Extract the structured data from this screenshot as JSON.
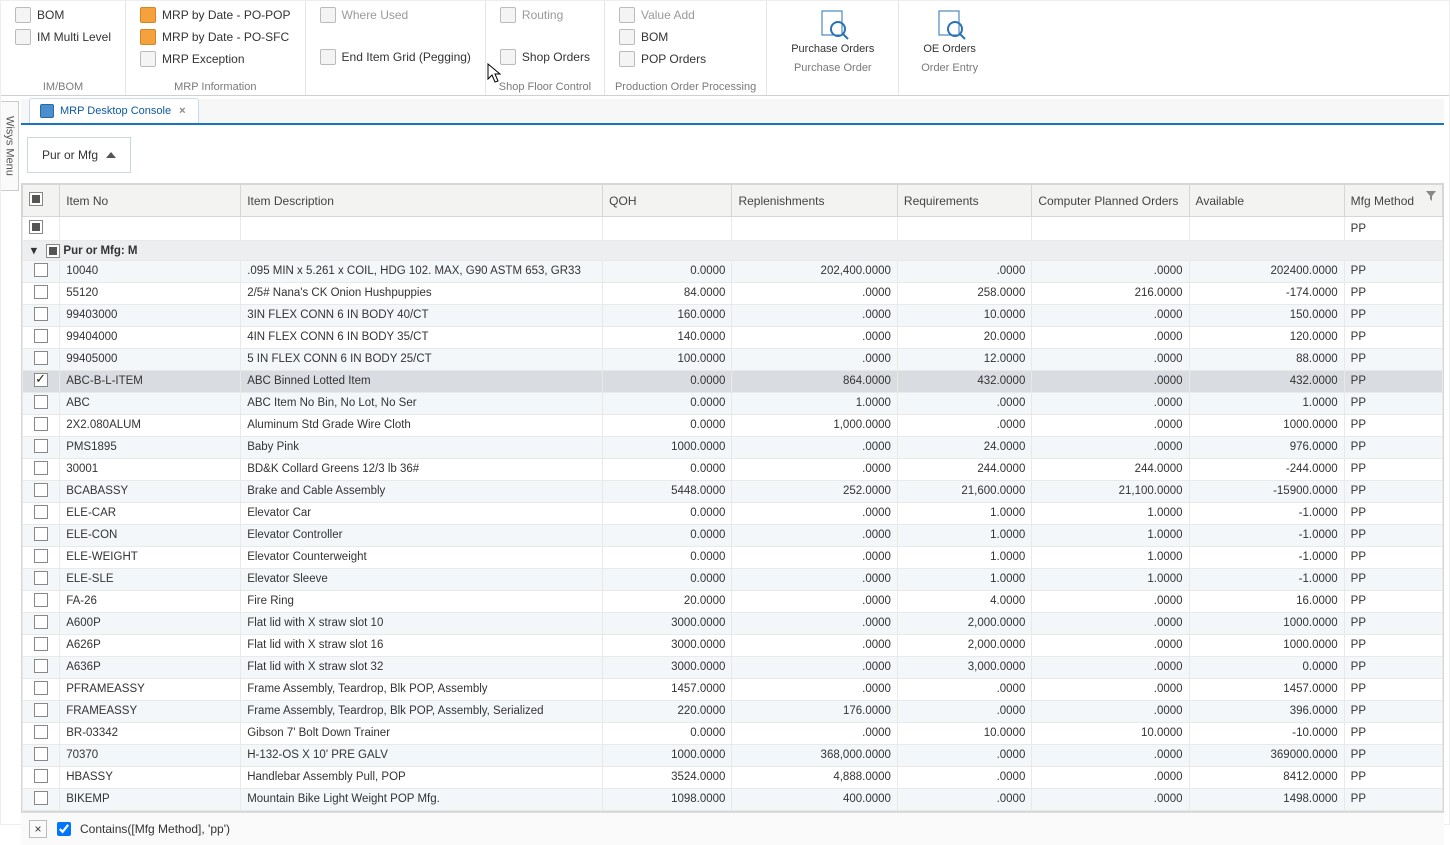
{
  "ribbon": {
    "group1": {
      "bom": "BOM",
      "imMulti": "IM Multi Level",
      "label": "IM/BOM"
    },
    "group2": {
      "byDatePop": "MRP by Date - PO-POP",
      "byDateSfc": "MRP by Date - PO-SFC",
      "exception": "MRP Exception",
      "label": "MRP Information"
    },
    "group3": {
      "whereUsed": "Where Used",
      "endItem": "End Item Grid (Pegging)"
    },
    "group4": {
      "routing": "Routing",
      "shopOrders": "Shop Orders",
      "label": "Shop Floor Control"
    },
    "group5": {
      "valueAdd": "Value Add",
      "bom": "BOM",
      "popOrders": "POP Orders",
      "label": "Production Order Processing"
    },
    "group6": {
      "purchase": "Purchase Orders",
      "label": "Purchase Order"
    },
    "group7": {
      "oe": "OE Orders",
      "label": "Order Entry"
    }
  },
  "sideTab": "Wisys Menu",
  "tab": {
    "title": "MRP Desktop Console"
  },
  "groupChip": {
    "label": "Pur or Mfg"
  },
  "columns": {
    "itemNo": "Item No",
    "desc": "Item Description",
    "qoh": "QOH",
    "repl": "Replenishments",
    "req": "Requirements",
    "cpo": "Computer Planned Orders",
    "avail": "Available",
    "mfg": "Mfg Method"
  },
  "filterRow": {
    "mfg": "PP"
  },
  "groupRow": "Pur or Mfg: M",
  "rows": [
    {
      "chk": false,
      "no": "10040",
      "desc": ".095 MIN x 5.261 x COIL, HDG   102. MAX, G90 ASTM 653, GR33",
      "qoh": "0.0000",
      "repl": "202,400.0000",
      "req": ".0000",
      "cpo": ".0000",
      "avail": "202400.0000",
      "mfg": "PP"
    },
    {
      "chk": false,
      "no": "55120",
      "desc": "2/5# Nana's CK Onion          Hushpuppies",
      "qoh": "84.0000",
      "repl": ".0000",
      "req": "258.0000",
      "cpo": "216.0000",
      "avail": "-174.0000",
      "mfg": "PP"
    },
    {
      "chk": false,
      "no": "99403000",
      "desc": "3IN FLEX CONN 6 IN BODY 40/CT",
      "qoh": "160.0000",
      "repl": ".0000",
      "req": "10.0000",
      "cpo": ".0000",
      "avail": "150.0000",
      "mfg": "PP"
    },
    {
      "chk": false,
      "no": "99404000",
      "desc": "4IN FLEX CONN 6 IN BODY 35/CT",
      "qoh": "140.0000",
      "repl": ".0000",
      "req": "20.0000",
      "cpo": ".0000",
      "avail": "120.0000",
      "mfg": "PP"
    },
    {
      "chk": false,
      "no": "99405000",
      "desc": "5 IN FLEX CONN 6 IN BODY 25/CT",
      "qoh": "100.0000",
      "repl": ".0000",
      "req": "12.0000",
      "cpo": ".0000",
      "avail": "88.0000",
      "mfg": "PP"
    },
    {
      "chk": true,
      "sel": true,
      "no": "ABC-B-L-ITEM",
      "desc": "ABC Binned Lotted Item",
      "qoh": "0.0000",
      "repl": "864.0000",
      "req": "432.0000",
      "cpo": ".0000",
      "avail": "432.0000",
      "mfg": "PP"
    },
    {
      "chk": false,
      "no": "ABC",
      "desc": "ABC Item                     No Bin, No Lot, No Ser",
      "qoh": "0.0000",
      "repl": "1.0000",
      "req": ".0000",
      "cpo": ".0000",
      "avail": "1.0000",
      "mfg": "PP"
    },
    {
      "chk": false,
      "no": "2X2.080ALUM",
      "desc": "Aluminum Std Grade Wire Cloth",
      "qoh": "0.0000",
      "repl": "1,000.0000",
      "req": ".0000",
      "cpo": ".0000",
      "avail": "1000.0000",
      "mfg": "PP"
    },
    {
      "chk": false,
      "no": "PMS1895",
      "desc": "Baby Pink",
      "qoh": "1000.0000",
      "repl": ".0000",
      "req": "24.0000",
      "cpo": ".0000",
      "avail": "976.0000",
      "mfg": "PP"
    },
    {
      "chk": false,
      "no": "30001",
      "desc": "BD&K Collard Greens          12/3 lb 36#",
      "qoh": "0.0000",
      "repl": ".0000",
      "req": "244.0000",
      "cpo": "244.0000",
      "avail": "-244.0000",
      "mfg": "PP"
    },
    {
      "chk": false,
      "no": "BCABASSY",
      "desc": "Brake and Cable Assembly",
      "qoh": "5448.0000",
      "repl": "252.0000",
      "req": "21,600.0000",
      "cpo": "21,100.0000",
      "avail": "-15900.0000",
      "mfg": "PP"
    },
    {
      "chk": false,
      "no": "ELE-CAR",
      "desc": "Elevator Car",
      "qoh": "0.0000",
      "repl": ".0000",
      "req": "1.0000",
      "cpo": "1.0000",
      "avail": "-1.0000",
      "mfg": "PP"
    },
    {
      "chk": false,
      "no": "ELE-CON",
      "desc": "Elevator Controller",
      "qoh": "0.0000",
      "repl": ".0000",
      "req": "1.0000",
      "cpo": "1.0000",
      "avail": "-1.0000",
      "mfg": "PP"
    },
    {
      "chk": false,
      "no": "ELE-WEIGHT",
      "desc": "Elevator Counterweight",
      "qoh": "0.0000",
      "repl": ".0000",
      "req": "1.0000",
      "cpo": "1.0000",
      "avail": "-1.0000",
      "mfg": "PP"
    },
    {
      "chk": false,
      "no": "ELE-SLE",
      "desc": "Elevator Sleeve",
      "qoh": "0.0000",
      "repl": ".0000",
      "req": "1.0000",
      "cpo": "1.0000",
      "avail": "-1.0000",
      "mfg": "PP"
    },
    {
      "chk": false,
      "no": "FA-26",
      "desc": "Fire Ring",
      "qoh": "20.0000",
      "repl": ".0000",
      "req": "4.0000",
      "cpo": ".0000",
      "avail": "16.0000",
      "mfg": "PP"
    },
    {
      "chk": false,
      "no": "A600P",
      "desc": "Flat lid with X straw slot 10",
      "qoh": "3000.0000",
      "repl": ".0000",
      "req": "2,000.0000",
      "cpo": ".0000",
      "avail": "1000.0000",
      "mfg": "PP"
    },
    {
      "chk": false,
      "no": "A626P",
      "desc": "Flat lid with X straw slot 16",
      "qoh": "3000.0000",
      "repl": ".0000",
      "req": "2,000.0000",
      "cpo": ".0000",
      "avail": "1000.0000",
      "mfg": "PP"
    },
    {
      "chk": false,
      "no": "A636P",
      "desc": "Flat lid with X straw slot 32",
      "qoh": "3000.0000",
      "repl": ".0000",
      "req": "3,000.0000",
      "cpo": ".0000",
      "avail": "0.0000",
      "mfg": "PP"
    },
    {
      "chk": false,
      "no": "PFRAMEASSY",
      "desc": "Frame Assembly, Teardrop, Blk POP, Assembly",
      "qoh": "1457.0000",
      "repl": ".0000",
      "req": ".0000",
      "cpo": ".0000",
      "avail": "1457.0000",
      "mfg": "PP"
    },
    {
      "chk": false,
      "no": "FRAMEASSY",
      "desc": "Frame Assembly, Teardrop, Blk POP, Assembly, Serialized",
      "qoh": "220.0000",
      "repl": "176.0000",
      "req": ".0000",
      "cpo": ".0000",
      "avail": "396.0000",
      "mfg": "PP"
    },
    {
      "chk": false,
      "no": "BR-03342",
      "desc": "Gibson 7' Bolt Down Trainer",
      "qoh": "0.0000",
      "repl": ".0000",
      "req": "10.0000",
      "cpo": "10.0000",
      "avail": "-10.0000",
      "mfg": "PP"
    },
    {
      "chk": false,
      "no": "70370",
      "desc": "H-132-OS X 10' PRE GALV",
      "qoh": "1000.0000",
      "repl": "368,000.0000",
      "req": ".0000",
      "cpo": ".0000",
      "avail": "369000.0000",
      "mfg": "PP"
    },
    {
      "chk": false,
      "no": "HBASSY",
      "desc": "Handlebar Assembly         Pull, POP",
      "qoh": "3524.0000",
      "repl": "4,888.0000",
      "req": ".0000",
      "cpo": ".0000",
      "avail": "8412.0000",
      "mfg": "PP"
    },
    {
      "chk": false,
      "no": "BIKEMP",
      "desc": "Mountain Bike Light Weight   POP Mfg.",
      "qoh": "1098.0000",
      "repl": "400.0000",
      "req": ".0000",
      "cpo": ".0000",
      "avail": "1498.0000",
      "mfg": "PP"
    }
  ],
  "footerFilter": "Contains([Mfg Method], 'pp')"
}
